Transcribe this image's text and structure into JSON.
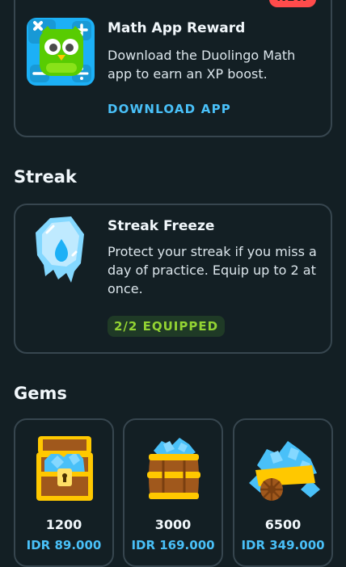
{
  "math_reward": {
    "badge": "NEW",
    "title": "Math App Reward",
    "description": "Download the Duolingo Math app to earn an XP boost.",
    "action": "DOWNLOAD APP"
  },
  "streak": {
    "section_title": "Streak",
    "item_title": "Streak Freeze",
    "item_description": "Protect your streak if you miss a day of practice. Equip up to 2 at once.",
    "status": "2/2 EQUIPPED"
  },
  "gems": {
    "section_title": "Gems",
    "packs": [
      {
        "amount": "1200",
        "price": "IDR 89.000",
        "icon": "gem-chest-icon"
      },
      {
        "amount": "3000",
        "price": "IDR 169.000",
        "icon": "gem-barrel-icon"
      },
      {
        "amount": "6500",
        "price": "IDR 349.000",
        "icon": "gem-cart-icon"
      }
    ]
  },
  "colors": {
    "background": "#131f24",
    "border": "#37464f",
    "accent_blue": "#49c0f8",
    "badge_red": "#ff4b4b",
    "equipped_green": "#93d333"
  }
}
